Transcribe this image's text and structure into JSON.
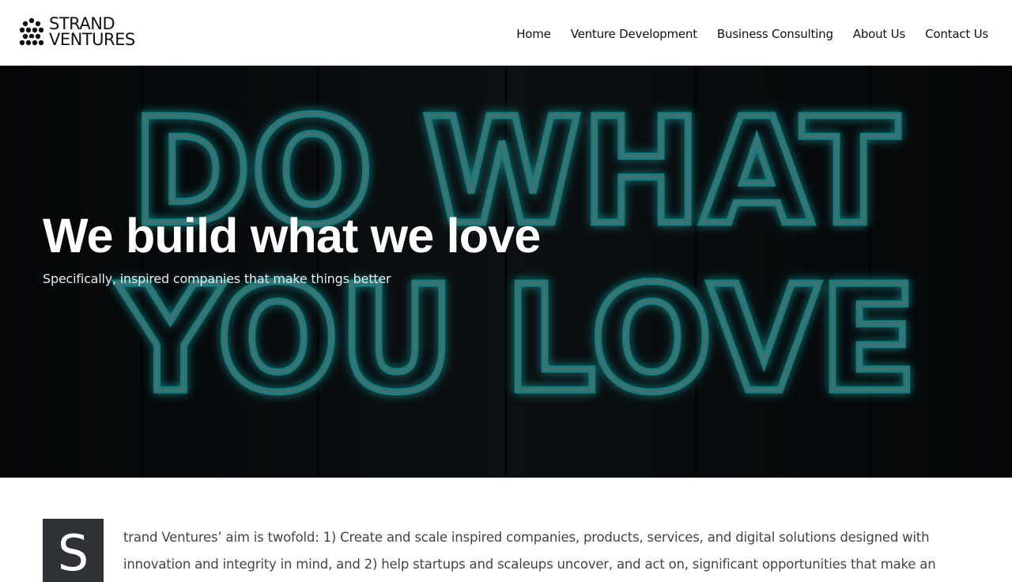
{
  "brand": {
    "line1": "STRAND",
    "line2": "VENTURES"
  },
  "nav": {
    "items": [
      {
        "label": "Home"
      },
      {
        "label": "Venture Development"
      },
      {
        "label": "Business Consulting"
      },
      {
        "label": "About Us"
      },
      {
        "label": "Contact Us"
      }
    ]
  },
  "hero": {
    "title": "We build what we love",
    "subtitle": "Specifically, inspired companies that make things better",
    "neon_line1": "DO WHAT",
    "neon_line2": "YOU LOVE",
    "neon_color": "#1aa8a8"
  },
  "intro": {
    "dropcap": "S",
    "text": "trand Ventures’ aim is twofold: 1) Create and scale inspired companies, products, services, and digital solutions designed with innovation and integrity in mind, and 2) help startups and scaleups uncover, and act on, significant opportunities that make an"
  }
}
